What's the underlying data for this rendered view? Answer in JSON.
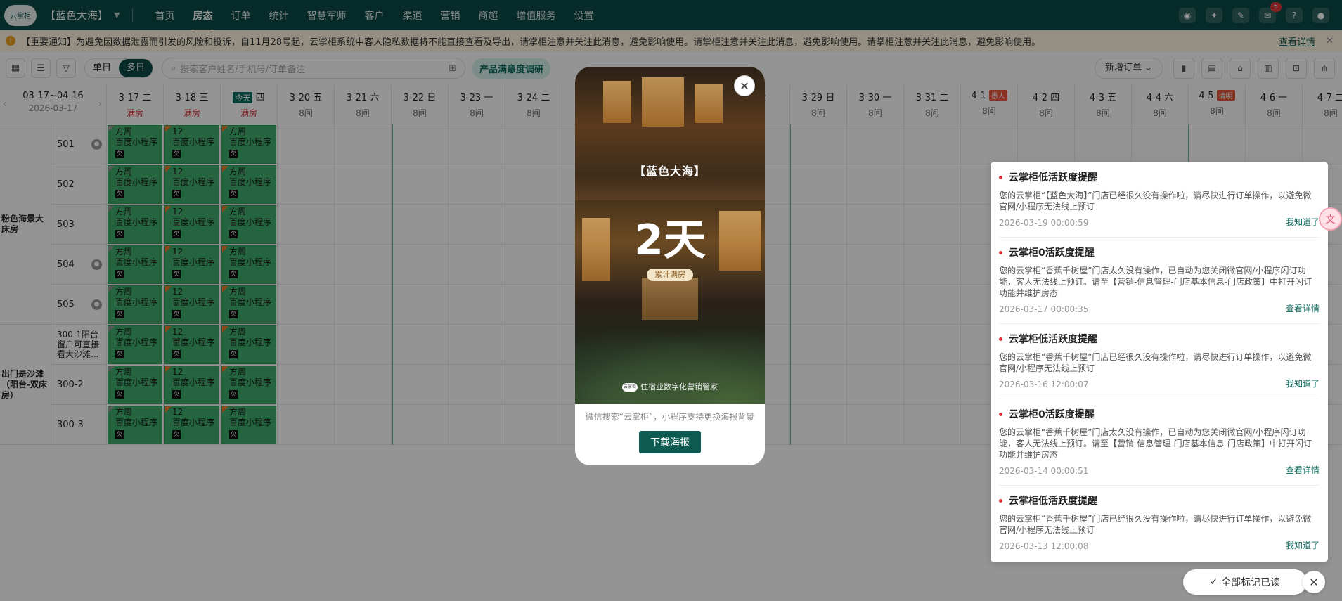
{
  "nav": {
    "logo": "云掌柜",
    "store": "【蓝色大海】",
    "items": [
      "首页",
      "房态",
      "订单",
      "统计",
      "智慧军师",
      "客户",
      "渠道",
      "营销",
      "商超",
      "增值服务",
      "设置"
    ],
    "active_item": "房态",
    "message_count": "5"
  },
  "notice": {
    "text": "【重要通知】为避免因数据泄露而引发的风险和投诉，自11月28号起，云掌柜系统中客人隐私数据将不能直接查看及导出，请掌柜注意并关注此消息，避免影响使用。请掌柜注意并关注此消息，避免影响使用。请掌柜注意并关注此消息，避免影响使用。",
    "link": "查看详情"
  },
  "toolbar": {
    "single_day": "单日",
    "multi_day": "多日",
    "search_placeholder": "搜索客户姓名/手机号/订单备注",
    "survey": "产品满意度调研",
    "new_order": "新增订单"
  },
  "calendar": {
    "range": "03-17~04-16",
    "current": "2026-03-17",
    "days": [
      {
        "date": "3-17",
        "weekday": "二",
        "sub": "满房",
        "full": true
      },
      {
        "date": "3-18",
        "weekday": "三",
        "sub": "满房",
        "full": true
      },
      {
        "date": "",
        "weekday": "四",
        "sub": "满房",
        "full": true,
        "today": "今天"
      },
      {
        "date": "3-20",
        "weekday": "五",
        "sub": "8间"
      },
      {
        "date": "3-21",
        "weekday": "六",
        "sub": "8间"
      },
      {
        "date": "3-22",
        "weekday": "日",
        "sub": "8间"
      },
      {
        "date": "3-23",
        "weekday": "一",
        "sub": "8间"
      },
      {
        "date": "3-24",
        "weekday": "二",
        "sub": "8间"
      },
      {
        "date": "",
        "weekday": "",
        "sub": ""
      },
      {
        "date": "",
        "weekday": "",
        "sub": ""
      },
      {
        "date": "",
        "weekday": "",
        "sub": ""
      },
      {
        "date": "",
        "weekday": "六",
        "sub": ""
      },
      {
        "date": "3-29",
        "weekday": "日",
        "sub": "8间"
      },
      {
        "date": "3-30",
        "weekday": "一",
        "sub": "8间"
      },
      {
        "date": "3-31",
        "weekday": "二",
        "sub": "8间"
      },
      {
        "date": "4-1",
        "weekday": "",
        "sub": "8间",
        "holiday": "愚人"
      },
      {
        "date": "4-2",
        "weekday": "四",
        "sub": "8间"
      },
      {
        "date": "4-3",
        "weekday": "五",
        "sub": "8间"
      },
      {
        "date": "4-4",
        "weekday": "六",
        "sub": "8间"
      },
      {
        "date": "4-5",
        "weekday": "",
        "sub": "8间",
        "holiday": "清明"
      },
      {
        "date": "4-6",
        "weekday": "一",
        "sub": "8间"
      },
      {
        "date": "4-7",
        "weekday": "二",
        "sub": "8间"
      }
    ],
    "groups": [
      {
        "name": "粉色海景大床房",
        "rows": 5
      },
      {
        "name": "出门是沙滩（阳台-双床房）",
        "rows": 3
      }
    ],
    "rooms": [
      {
        "name": "501",
        "locked": true
      },
      {
        "name": "502",
        "locked": false
      },
      {
        "name": "503",
        "locked": false
      },
      {
        "name": "504",
        "locked": true
      },
      {
        "name": "505",
        "locked": true
      },
      {
        "name": "300-1阳台窗户可直接看大沙滩...",
        "locked": false
      },
      {
        "name": "300-2",
        "locked": false
      },
      {
        "name": "300-3",
        "locked": false
      }
    ],
    "bookings": [
      {
        "name": "方周",
        "source": "百度小程序",
        "tag": "欠",
        "corner": "grey"
      },
      {
        "name": "12",
        "source": "百度小程序",
        "tag": "欠",
        "corner": "orange"
      },
      {
        "name": "方周",
        "source": "百度小程序",
        "tag": "欠",
        "corner": "orange"
      }
    ]
  },
  "notifications": [
    {
      "title": "云掌柜低活跃度提醒",
      "body": "您的云掌柜“【蓝色大海】”门店已经很久没有操作啦，请尽快进行订单操作，以避免微官网/小程序无法线上预订",
      "time": "2026-03-19 00:00:59",
      "action": "我知道了"
    },
    {
      "title": "云掌柜0活跃度提醒",
      "body": "您的云掌柜“香蕉千树屋”门店太久没有操作，已自动为您关闭微官网/小程序闪订功能，客人无法线上预订。请至【营销-信息管理-门店基本信息-门店政策】中打开闪订功能并维护房态",
      "time": "2026-03-17 00:00:35",
      "action": "查看详情"
    },
    {
      "title": "云掌柜低活跃度提醒",
      "body": "您的云掌柜“香蕉千树屋”门店已经很久没有操作啦，请尽快进行订单操作，以避免微官网/小程序无法线上预订",
      "time": "2026-03-16 12:00:07",
      "action": "我知道了"
    },
    {
      "title": "云掌柜0活跃度提醒",
      "body": "您的云掌柜“香蕉千树屋”门店太久没有操作，已自动为您关闭微官网/小程序闪订功能，客人无法线上预订。请至【营销-信息管理-门店基本信息-门店政策】中打开闪订功能并维护房态",
      "time": "2026-03-14 00:00:51",
      "action": "查看详情"
    },
    {
      "title": "云掌柜低活跃度提醒",
      "body": "您的云掌柜“香蕉千树屋”门店已经很久没有操作啦，请尽快进行订单操作，以避免微官网/小程序无法线上预订",
      "time": "2026-03-13 12:00:08",
      "action": "我知道了"
    }
  ],
  "mark_all_read": "全部标记已读",
  "modal": {
    "store": "【蓝色大海】",
    "days": "2天",
    "label": "累计满房",
    "brand": "住宿业数字化营销管家",
    "brand_logo": "云掌柜",
    "hint": "微信搜索“云掌柜”，小程序支持更换海报背景",
    "button": "下载海报"
  }
}
